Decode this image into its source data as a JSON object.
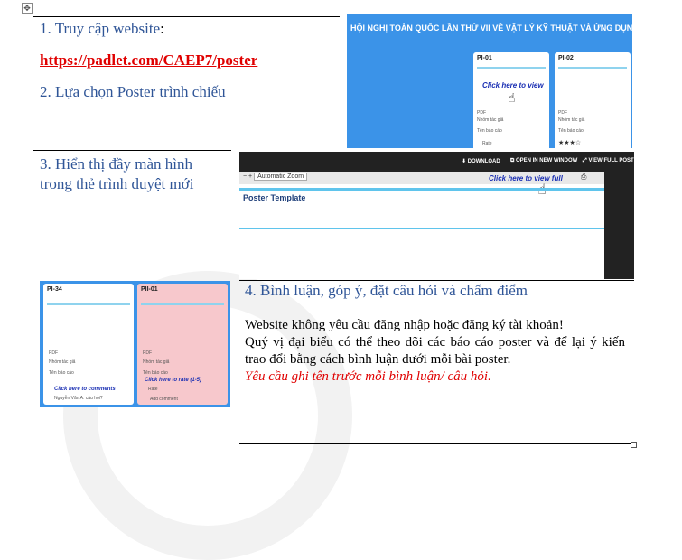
{
  "step1": {
    "label": "1. Truy cập website",
    "colon": ":"
  },
  "link": "https://padlet.com/CAEP7/poster",
  "step2": "2. Lựa chọn Poster trình chiếu",
  "step3": "3. Hiển thị đầy màn hình trong thẻ trình duyệt mới",
  "step4": "4. Bình luận, góp ý, đặt câu hỏi và chấm điểm",
  "shot1": {
    "header": "HỘI NGHỊ TOÀN QUỐC LẦN THỨ VII VỀ VẬT LÝ KỸ THUẬT VÀ ỨNG DỤNG",
    "card_a_title": "PI-01",
    "card_b_title": "PI-02",
    "overlay": "Click here to view",
    "pdf": "PDF",
    "author": "Nhóm tác giả",
    "report": "Tên báo cáo",
    "rate": "Rate"
  },
  "shot2": {
    "download": "DOWNLOAD",
    "open_new": "OPEN IN NEW WINDOW",
    "view_full": "VIEW FULL POST",
    "zoom": "Automatic Zoom",
    "overlay": "Click here to view full",
    "poster": "Poster Template"
  },
  "shot3": {
    "card_a_title": "PI-34",
    "card_b_title": "PII-01",
    "comments": "Click here to comments",
    "rate": "Click here to rate (1-5)",
    "pdf": "PDF",
    "author": "Nhóm tác giả",
    "report": "Tên báo cáo",
    "add_comment": "Add comment",
    "rate_label": "Rate",
    "commenter": "Nguyễn Văn A: câu hỏi?"
  },
  "description": {
    "line1": "Website không yêu cầu đăng nhập hoặc đăng ký tài khoản!",
    "line2": "Quý vị đại biểu có thể theo dõi các báo cáo poster và để lại ý kiến trao đổi bằng cách bình luận dưới mỗi bài poster.",
    "note": "Yêu cầu ghi tên trước mỗi bình luận/ câu hỏi."
  },
  "colors": {
    "step": "#2f5597",
    "link": "#e00000",
    "note": "#e00000",
    "padlet_blue": "#3b93e8"
  }
}
